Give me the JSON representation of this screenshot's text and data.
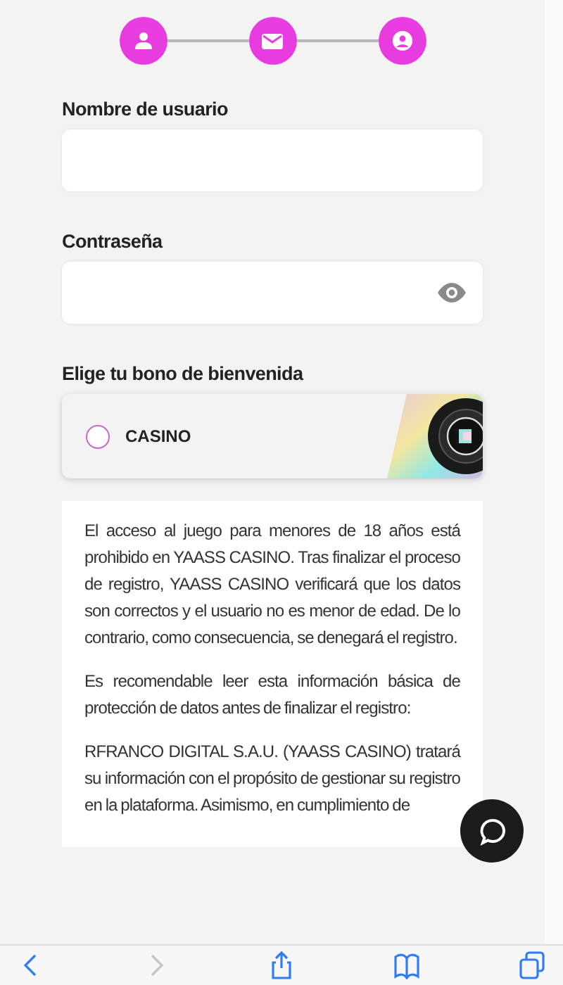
{
  "stepper": {
    "steps": [
      {
        "kind": "user"
      },
      {
        "kind": "mail"
      },
      {
        "kind": "profile"
      }
    ]
  },
  "fields": [
    {
      "label": "Nombre de usuario",
      "kind": "text"
    },
    {
      "label": "Contraseña",
      "kind": "password"
    }
  ],
  "bonus": {
    "label": "Elige tu bono de bienvenida",
    "options": [
      {
        "label": "CASINO",
        "selected": false
      }
    ]
  },
  "info": {
    "paragraphs": [
      "El acceso al juego para menores de 18 años está prohibido en YAASS CASINO. Tras finalizar el proceso de registro, YAASS CASINO verificará que los datos son correctos y el usuario no es menor de edad. De lo contrario, como consecuencia, se denegará el registro.",
      "Es recomendable leer esta información básica de protección de datos antes de finalizar el registro:",
      "RFRANCO DIGITAL S.A.U. (YAASS CASINO) tratará su información con el propósito de gestionar su registro en la plataforma. Asimismo, en cumplimiento de"
    ]
  },
  "browser_toolbar": {
    "buttons": [
      {
        "kind": "back",
        "disabled": false
      },
      {
        "kind": "forward",
        "disabled": true
      },
      {
        "kind": "share",
        "disabled": false
      },
      {
        "kind": "bookmarks",
        "disabled": false
      },
      {
        "kind": "tabs",
        "disabled": false
      }
    ]
  }
}
